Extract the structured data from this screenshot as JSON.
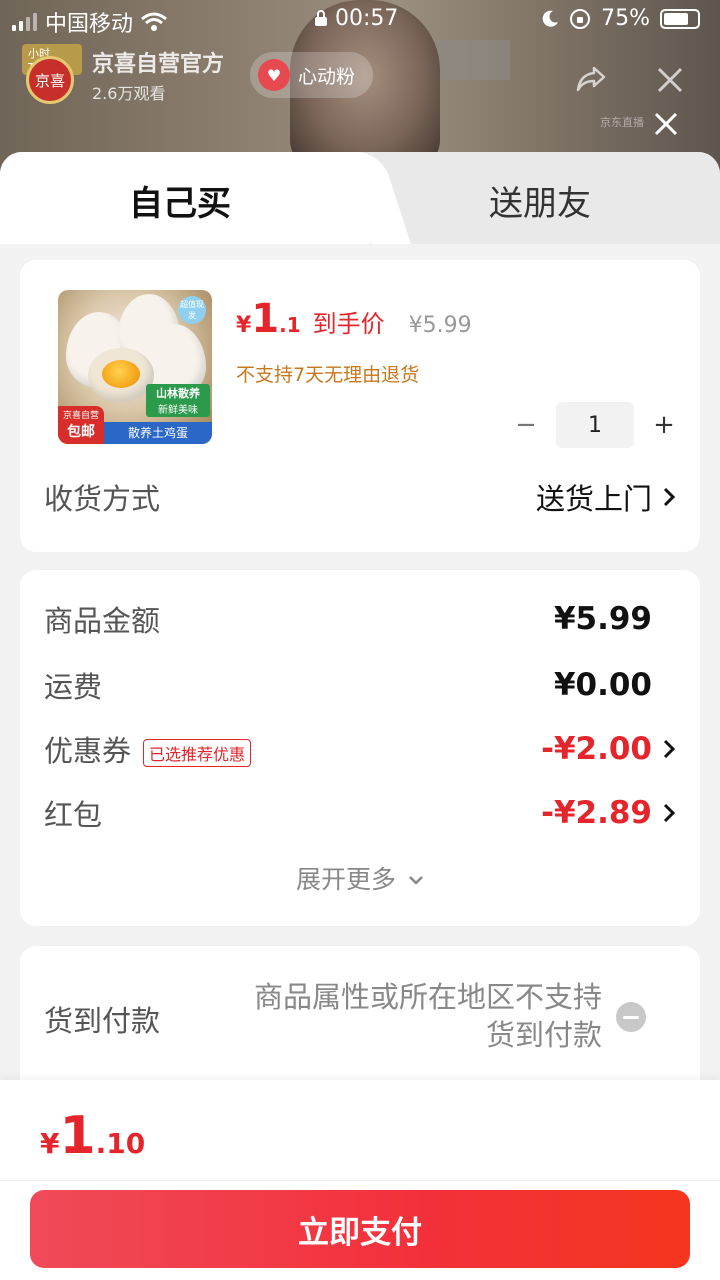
{
  "status_bar": {
    "carrier": "中国移动",
    "time": "00:57",
    "battery": "75%",
    "battery_level": 0.75
  },
  "live": {
    "top_badge": "小时TOP1",
    "logo_text": "京喜",
    "shop_name": "京喜自营官方",
    "views": "2.6万观看",
    "fan_button": "心动粉"
  },
  "watermark": "京东直播",
  "tabs": [
    {
      "label": "自己买",
      "active": true
    },
    {
      "label": "送朋友",
      "active": false
    }
  ],
  "product": {
    "thumb_tags": {
      "top_right": "超值现发",
      "green_title": "山林散养",
      "green_sub": "新鲜美味",
      "red_top": "京喜自营",
      "red_main": "包邮",
      "blue": "散养土鸡蛋"
    },
    "price_symbol": "¥",
    "price_int": "1",
    "price_dec": ".1",
    "price_label": "到手价",
    "original_price": "¥5.99",
    "return_note": "不支持7天无理由退货",
    "quantity": "1",
    "delivery_label": "收货方式",
    "delivery_value": "送货上门"
  },
  "costs": {
    "items": [
      {
        "label": "商品金额",
        "amount": "¥5.99"
      },
      {
        "label": "运费",
        "amount": "¥0.00"
      },
      {
        "label": "优惠券",
        "tag": "已选推荐优惠",
        "amount": "-¥2.00"
      },
      {
        "label": "红包",
        "amount": "-¥2.89"
      }
    ],
    "expand_label": "展开更多"
  },
  "cod": {
    "label": "货到付款",
    "note_line1": "商品属性或所在地区不支持",
    "note_line2": "货到付款"
  },
  "footer": {
    "total_symbol": "¥",
    "total_int": "1",
    "total_dec": ".10",
    "pay_button": "立即支付"
  },
  "colors": {
    "accent_red": "#e4252b",
    "note_orange": "#c8771b"
  }
}
